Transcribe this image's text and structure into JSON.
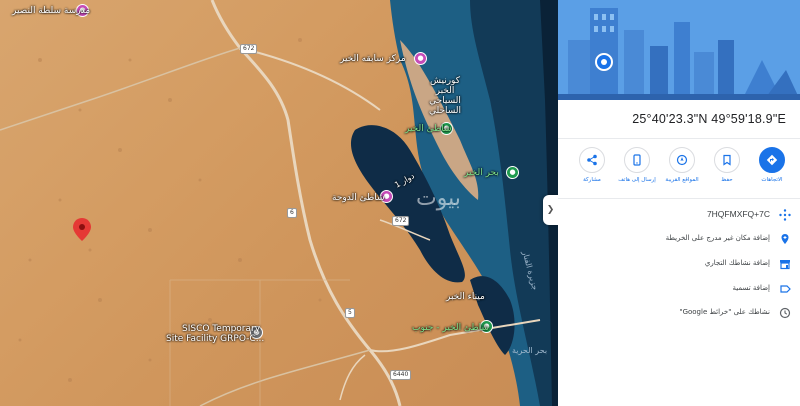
{
  "map": {
    "labels": {
      "poi_top_left": "مدرسة سلطة النصير",
      "poi_hotel": "مركز سابقه الخير",
      "poi_resort": "كورنيش الخبر السياحي الساحلي",
      "beach_kheir": "شاطئ الخير",
      "sea_kheir": "بحر الخير",
      "port": "شاطئ الدوحة",
      "dawar": "دوار 1",
      "watermark": "بيوت",
      "pier": "ميناء الخبر",
      "beach_south": "شاطئ الخير - جنوب",
      "sea_bottom": "بحر الحرية",
      "island": "جزيرة الفنار",
      "sisco_line1": "SISCO Temporary",
      "sisco_line2": "Site Facility GRPO-C..."
    },
    "road_badges": {
      "r672_top": "672",
      "r6": "6",
      "r5": "5",
      "r672_mid": "672",
      "r6440": "6440"
    },
    "collapse_glyph": "❯"
  },
  "panel": {
    "coordinates": "25°40'23.3\"N 49°59'18.9\"E",
    "actions": [
      {
        "label": "مشاركة",
        "icon": "share-icon"
      },
      {
        "label": "إرسال إلى هاتف",
        "icon": "phone-icon"
      },
      {
        "label": "المواقع القريبة",
        "icon": "nearby-icon"
      },
      {
        "label": "حفظ",
        "icon": "bookmark-icon"
      },
      {
        "label": "الاتجاهات",
        "icon": "directions-icon"
      }
    ],
    "info_rows": [
      {
        "text": "7HQFMXFQ+7C",
        "icon": "plus-code-icon"
      },
      {
        "text": "إضافة مكان غير مدرج على الخريطة",
        "icon": "add-place-icon"
      },
      {
        "text": "إضافة نشاطك التجاري",
        "icon": "store-icon"
      },
      {
        "text": "إضافة تسمية",
        "icon": "label-icon"
      },
      {
        "text": "نشاطك على \"خرائط Google\"",
        "icon": "history-icon"
      }
    ]
  },
  "colors": {
    "accent": "#1a73e8",
    "sea_deep": "#0d2a45",
    "desert": "#d49c62"
  }
}
